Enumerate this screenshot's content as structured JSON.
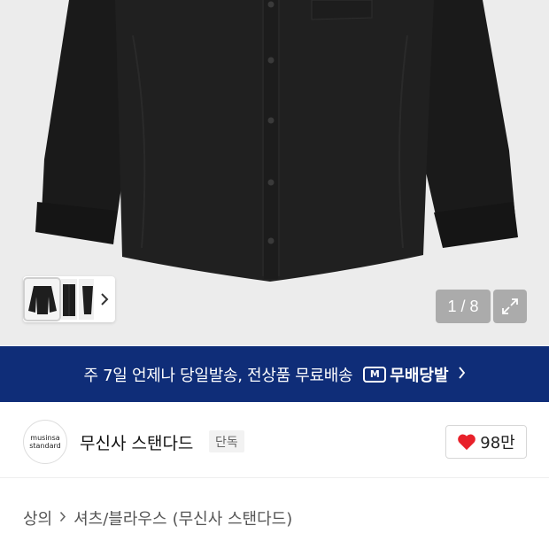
{
  "gallery": {
    "counter": "1 / 8",
    "thumbnail_next_icon": "chevron-right-icon",
    "expand_icon": "expand-arrows-icon"
  },
  "banner": {
    "text": "주 7일 언제나 당일발송, 전상품 무료배송",
    "badge_icon_letter": "M",
    "badge_label": "무배당발"
  },
  "brand": {
    "logo_line1": "musinsa",
    "logo_line2": "standard",
    "name": "무신사 스탠다드",
    "tag": "단독",
    "likes": "98만",
    "like_color": "#e8212a"
  },
  "breadcrumb": {
    "items": [
      "상의",
      "셔츠/블라우스",
      "(무신사 스탠다드)"
    ]
  },
  "product": {
    "title_partial": ""
  },
  "colors": {
    "banner_bg": "#0f2d78",
    "shirt": "#1b1b1b"
  }
}
